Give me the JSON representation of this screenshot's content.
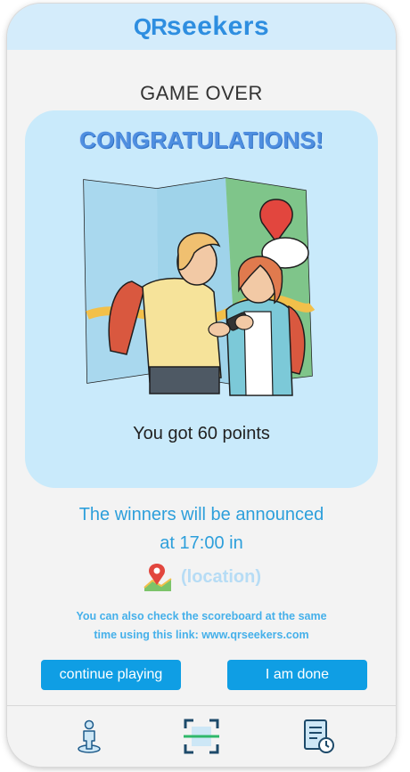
{
  "header": {
    "logo_qr": "QR",
    "logo_word": "seekers"
  },
  "title": "GAME OVER",
  "card": {
    "congrats": "CONGRATULATIONS!",
    "points_text": "You got 60 points"
  },
  "announcement": {
    "line1": "The winners will be announced",
    "line2": "at 17:00 in",
    "location_label": "(location)"
  },
  "scoreboard_note": {
    "line1": "You can also check the scoreboard at the same",
    "line2": "time using this link: www.qrseekers.com"
  },
  "buttons": {
    "continue": "continue playing",
    "done": "I am done"
  },
  "nav": [
    "person-icon",
    "qr-scan-icon",
    "scoreboard-icon"
  ],
  "colors": {
    "accent": "#0f9ee4",
    "header_bg": "#d4ecfb",
    "card_bg": "#c9eafb",
    "link_text": "#2d9fdb"
  }
}
